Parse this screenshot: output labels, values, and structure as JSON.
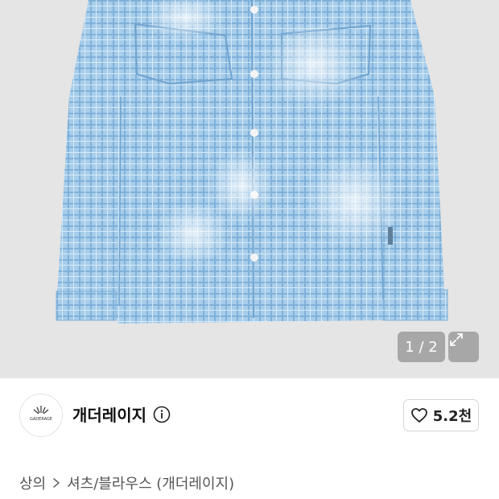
{
  "gallery": {
    "image_alt_icon": "shirt-product-photo",
    "counter": "1 / 2",
    "expand_icon": "expand-icon"
  },
  "brand": {
    "logo_icon": "brand-logo",
    "logo_text": "GADERAGE",
    "name": "개더레이지",
    "info_icon": "info-icon"
  },
  "like": {
    "icon": "heart-icon",
    "count": "5.2천"
  },
  "breadcrumb": {
    "category": "상의",
    "separator_icon": "chevron-right-icon",
    "subcategory": "셔츠/블라우스 (개더레이지)"
  }
}
